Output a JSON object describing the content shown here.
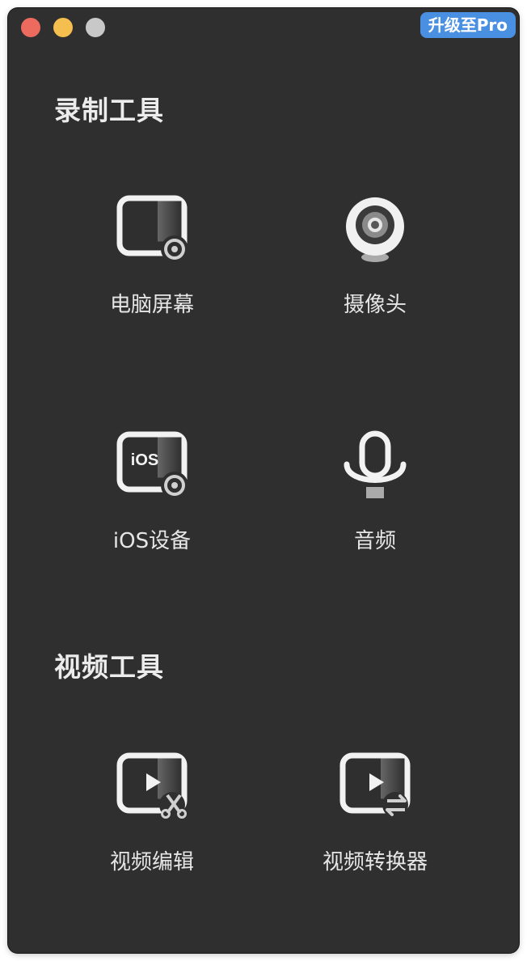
{
  "window": {
    "controls": [
      "close",
      "minimize",
      "maximize"
    ],
    "upgrade_label": "升级至Pro"
  },
  "sections": [
    {
      "title": "录制工具",
      "tools": [
        {
          "label": "电脑屏幕",
          "icon": "screen-record-icon"
        },
        {
          "label": "摄像头",
          "icon": "webcam-icon"
        },
        {
          "label": "iOS设备",
          "icon": "ios-record-icon",
          "icon_text": "iOS"
        },
        {
          "label": "音频",
          "icon": "microphone-icon"
        }
      ]
    },
    {
      "title": "视频工具",
      "tools": [
        {
          "label": "视频编辑",
          "icon": "video-edit-icon"
        },
        {
          "label": "视频转换器",
          "icon": "video-convert-icon"
        }
      ]
    }
  ],
  "colors": {
    "background": "#2f2f2f",
    "text": "#e6e6e6",
    "accent": "#4a90e2",
    "close": "#ec6a5e",
    "minimize": "#f4bf4f",
    "maximize": "#c8c8c8"
  }
}
